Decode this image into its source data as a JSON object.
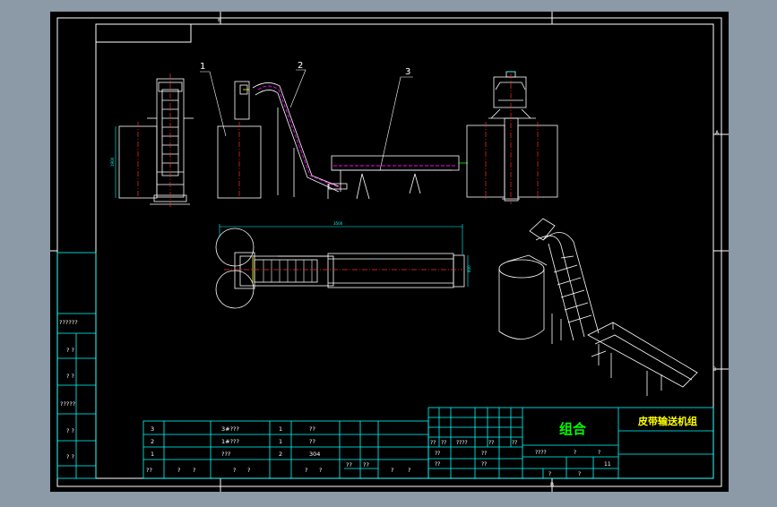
{
  "drawing": {
    "title_cn": "组合",
    "title_name": "皮带输送机组",
    "callouts": [
      "1",
      "2",
      "3"
    ],
    "dim_height": "1900",
    "dim_length": "3500",
    "dim_width": "600",
    "dim_width2": "600",
    "grid_letter_top": "B",
    "grid_letter_bottom": "B",
    "grid_letter_right_a": "A",
    "grid_letter_right_b": "B"
  },
  "left_block": {
    "labels": [
      "??????",
      "? ?",
      "? ?",
      "?????",
      "? ?",
      "? ?"
    ]
  },
  "bom": {
    "rows": [
      {
        "no": "3",
        "code": "3#???",
        "qty": "1",
        "mat": "??"
      },
      {
        "no": "2",
        "code": "1#???",
        "qty": "1",
        "mat": "??"
      },
      {
        "no": "1",
        "code": "???",
        "qty": "2",
        "mat": "304"
      }
    ],
    "header": [
      "??",
      "?",
      "?",
      "?",
      "?",
      "?",
      "?",
      "??",
      "??",
      "?",
      "?"
    ]
  },
  "title_block": {
    "row1": [
      "??",
      "??",
      "????",
      "??",
      "??"
    ],
    "row2": [
      "??",
      "??"
    ],
    "row3": [
      "??",
      "??"
    ],
    "scale_label": "????",
    "scale_mid": "?",
    "scale_right": "?",
    "sheet_num": "11",
    "sheet_a": "?",
    "sheet_b": "?"
  },
  "colors": {
    "frame": "#ffffff",
    "table_lines": "#00ffff",
    "outline": "#ffffff",
    "center_lines": "#ff2a2a",
    "belt": "#ff00ff",
    "title_text": "#00ff00",
    "highlight": "#ffff00"
  }
}
